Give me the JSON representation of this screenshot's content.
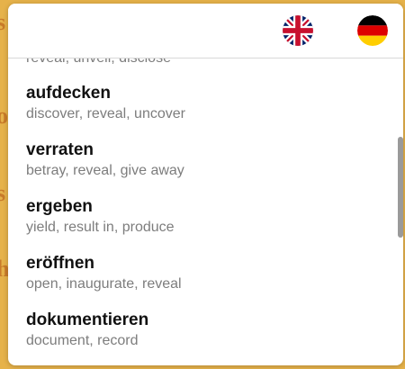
{
  "background_page": {
    "glyphs": [
      "s",
      "o",
      "s",
      "h"
    ]
  },
  "header": {
    "english_flag_icon": "uk-flag-icon",
    "german_flag_icon": "germany-flag-icon"
  },
  "results": {
    "partial_translation": "reveal, unveil, disclose",
    "entries": [
      {
        "word": "aufdecken",
        "translations": "discover, reveal, uncover"
      },
      {
        "word": "verraten",
        "translations": "betray, reveal, give away"
      },
      {
        "word": "ergeben",
        "translations": "yield, result in, produce"
      },
      {
        "word": "eröffnen",
        "translations": "open, inaugurate, reveal"
      },
      {
        "word": "dokumentieren",
        "translations": "document, record"
      }
    ]
  },
  "colors": {
    "page_background": "#e6b24a",
    "word_text": "#111111",
    "translation_text": "#7d7d7d",
    "scrollbar": "#9a9a9a"
  }
}
